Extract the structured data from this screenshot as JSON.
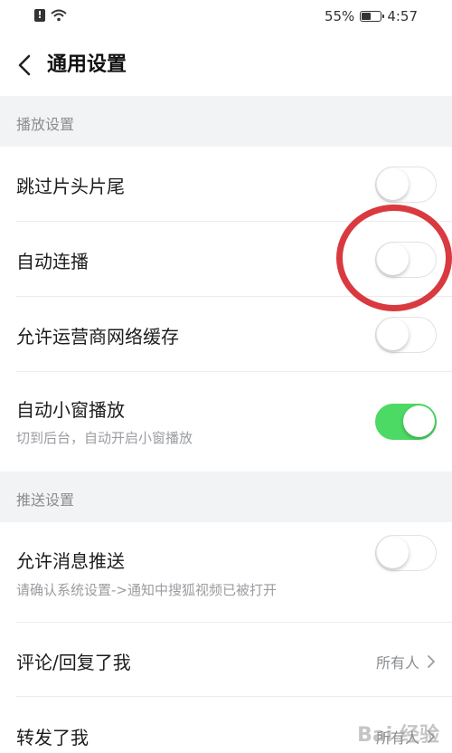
{
  "status_bar": {
    "battery": "55%",
    "battery_level": 0.55,
    "time": "4:57"
  },
  "header": {
    "title": "通用设置"
  },
  "sections": {
    "playback": {
      "header": "播放设置",
      "skip_intro_outro": {
        "label": "跳过片头片尾",
        "enabled": false
      },
      "autoplay_next": {
        "label": "自动连播",
        "enabled": false
      },
      "carrier_cache": {
        "label": "允许运营商网络缓存",
        "enabled": false
      },
      "mini_window": {
        "label": "自动小窗播放",
        "desc": "切到后台，自动开启小窗播放",
        "enabled": true
      }
    },
    "push": {
      "header": "推送设置",
      "allow_push": {
        "label": "允许消息推送",
        "desc": "请确认系统设置->通知中搜狐视频已被打开",
        "enabled": false
      },
      "comment_reply": {
        "label": "评论/回复了我",
        "value": "所有人"
      },
      "reposted": {
        "label": "转发了我",
        "value": "所有人"
      }
    }
  },
  "colors": {
    "toggle_on": "#4cd964",
    "annotation": "#d93a3f",
    "section_bg": "#f2f3f5"
  },
  "watermark": "Bai 经验"
}
